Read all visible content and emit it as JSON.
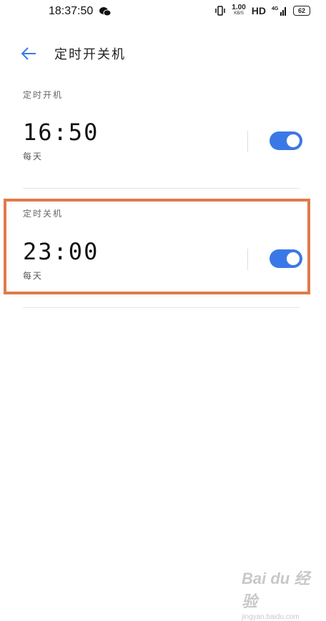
{
  "status_bar": {
    "time": "18:37:50",
    "net_speed_value": "1.00",
    "net_speed_unit": "KB/S",
    "hd": "HD",
    "network": "4G",
    "battery": "62"
  },
  "header": {
    "title": "定时开关机"
  },
  "power_on": {
    "label": "定时开机",
    "time": "16:50",
    "repeat": "每天",
    "enabled": true
  },
  "power_off": {
    "label": "定时关机",
    "time": "23:00",
    "repeat": "每天",
    "enabled": true
  },
  "colors": {
    "accent": "#3b78e7",
    "highlight": "#e07a4a"
  },
  "watermark": {
    "logo": "Bai du 经验",
    "url": "jingyan.baidu.com"
  }
}
